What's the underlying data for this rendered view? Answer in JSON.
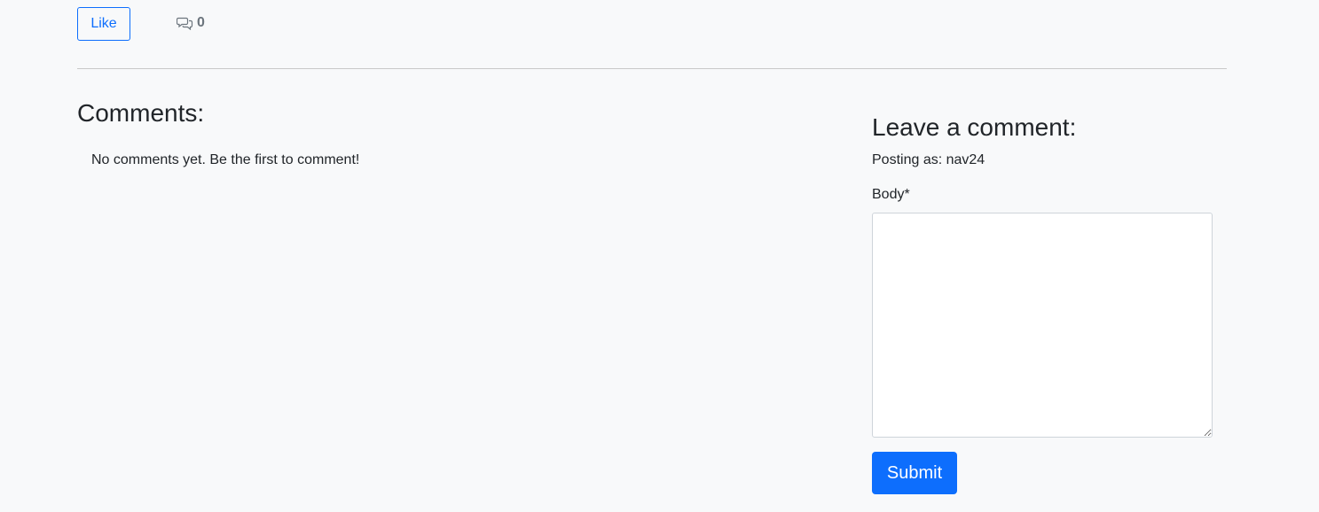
{
  "post_actions": {
    "like_label": "Like",
    "comment_icon": "chat-bubbles-icon",
    "comment_count": "0"
  },
  "comments": {
    "title": "Comments:",
    "empty_message": "No comments yet. Be the first to comment!"
  },
  "comment_form": {
    "title": "Leave a comment:",
    "posting_as": "Posting as: nav24",
    "body_label": "Body*",
    "body_value": "",
    "submit_label": "Submit"
  },
  "colors": {
    "primary": "#0d6efd",
    "background": "#f8f9fa",
    "muted": "#6c757d"
  }
}
